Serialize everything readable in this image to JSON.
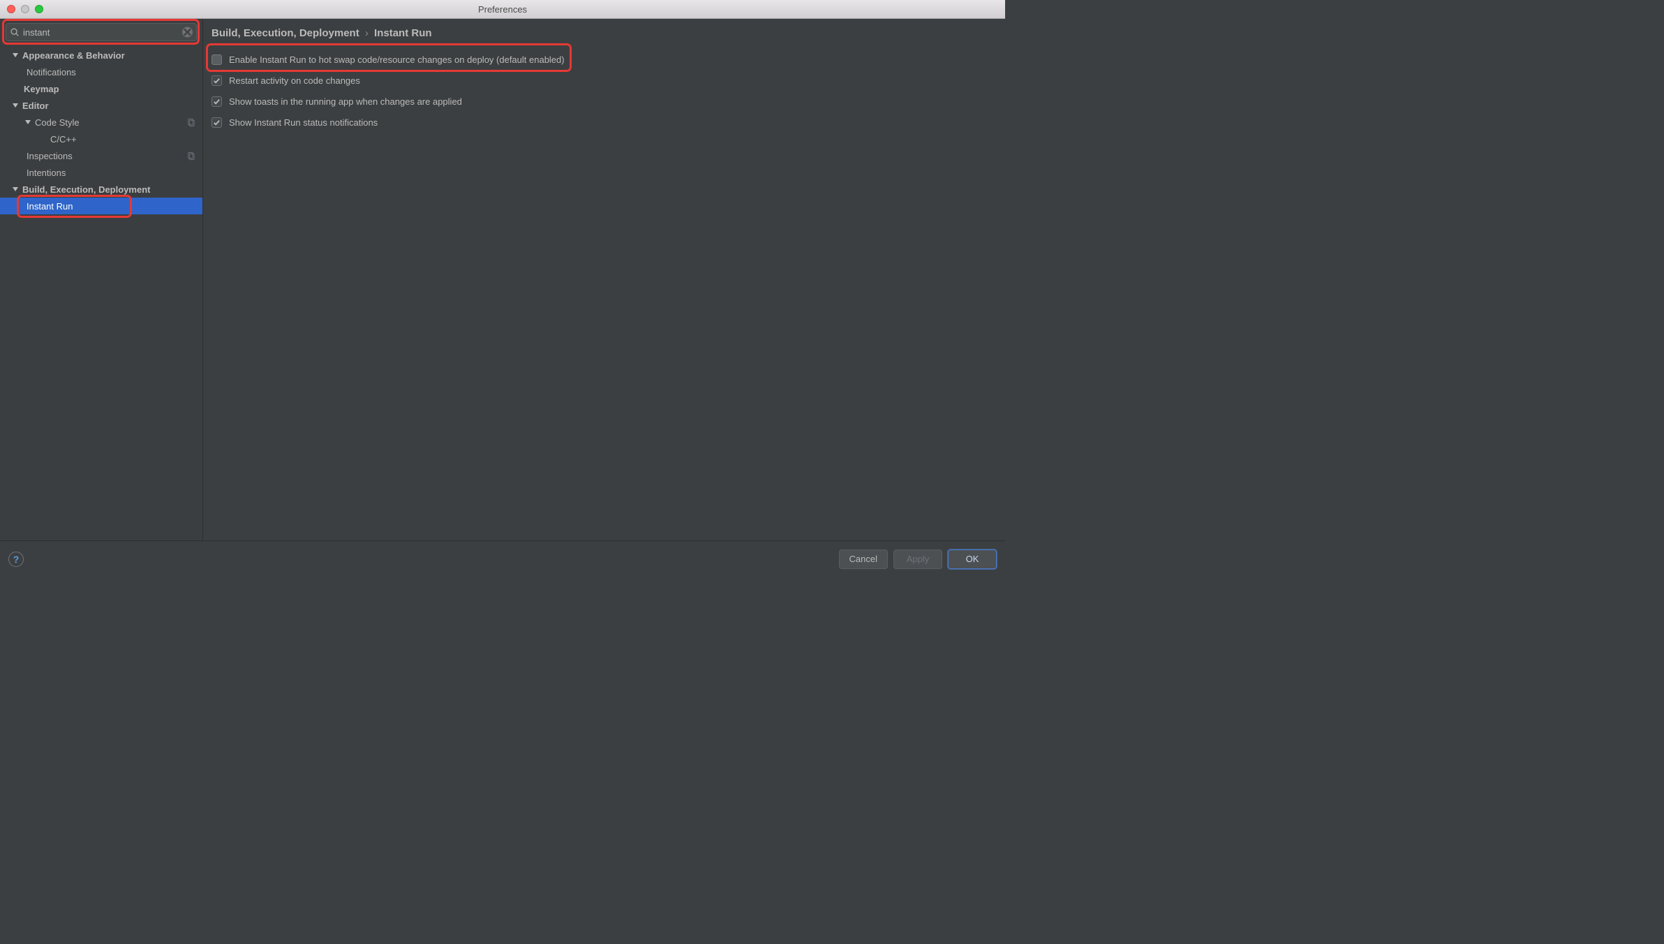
{
  "window": {
    "title": "Preferences"
  },
  "search": {
    "value": "instant"
  },
  "sidebar": {
    "items": [
      {
        "label": "Appearance & Behavior"
      },
      {
        "label": "Notifications"
      },
      {
        "label": "Keymap"
      },
      {
        "label": "Editor"
      },
      {
        "label": "Code Style"
      },
      {
        "label": "C/C++"
      },
      {
        "label": "Inspections"
      },
      {
        "label": "Intentions"
      },
      {
        "label": "Build, Execution, Deployment"
      },
      {
        "label": "Instant Run"
      }
    ]
  },
  "breadcrumb": {
    "parent": "Build, Execution, Deployment",
    "sep": "›",
    "current": "Instant Run"
  },
  "settings": {
    "opt0": "Enable Instant Run to hot swap code/resource changes on deploy (default enabled)",
    "opt1": "Restart activity on code changes",
    "opt2": "Show toasts in the running app when changes are applied",
    "opt3": "Show Instant Run status notifications"
  },
  "footer": {
    "cancel": "Cancel",
    "apply": "Apply",
    "ok": "OK"
  }
}
